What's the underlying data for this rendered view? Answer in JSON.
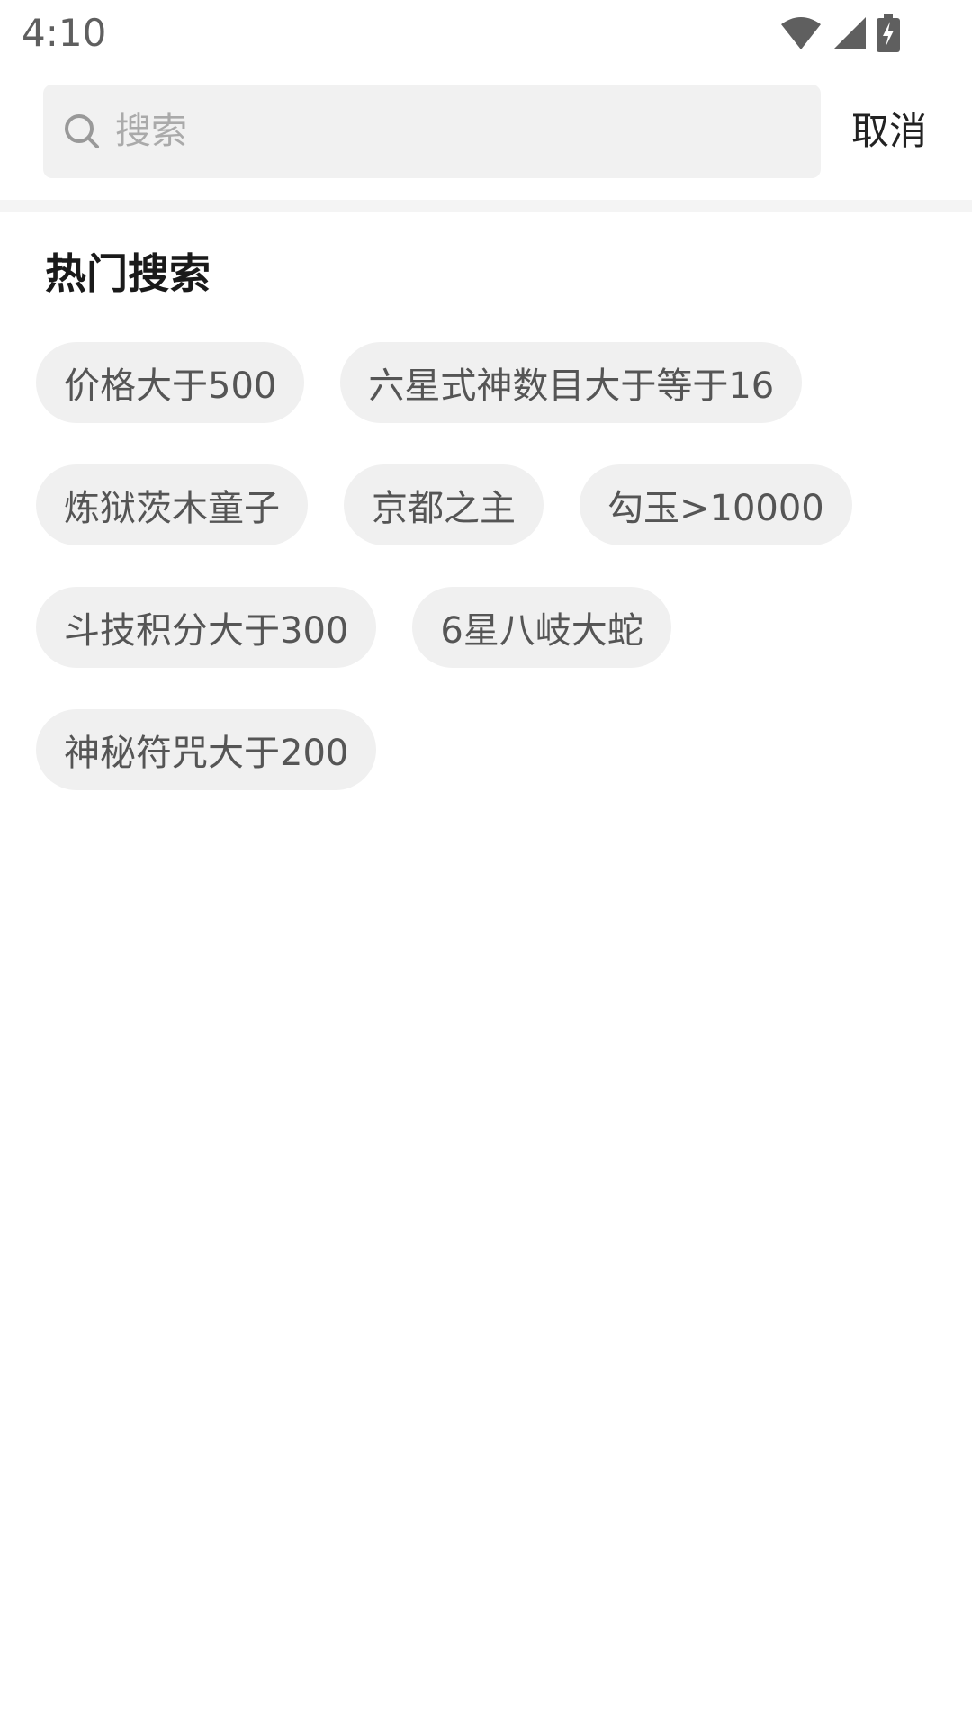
{
  "status_bar": {
    "time": "4:10",
    "icons": [
      "wifi-icon",
      "signal-icon",
      "battery-charging-icon"
    ]
  },
  "search": {
    "placeholder": "搜索",
    "value": "",
    "cancel_label": "取消",
    "icon": "search-icon"
  },
  "hot_search": {
    "title": "热门搜索",
    "tags": [
      [
        "价格大于500",
        "六星式神数目大于等于16"
      ],
      [
        "炼狱茨木童子",
        "京都之主",
        "勾玉>10000"
      ],
      [
        "斗技积分大于300",
        "6星八岐大蛇"
      ],
      [
        "神秘符咒大于200"
      ]
    ]
  },
  "colors": {
    "search_bg": "#f1f1f1",
    "tag_bg": "#f0f0f0",
    "tag_text": "#555555",
    "divider": "#f4f4f4"
  }
}
